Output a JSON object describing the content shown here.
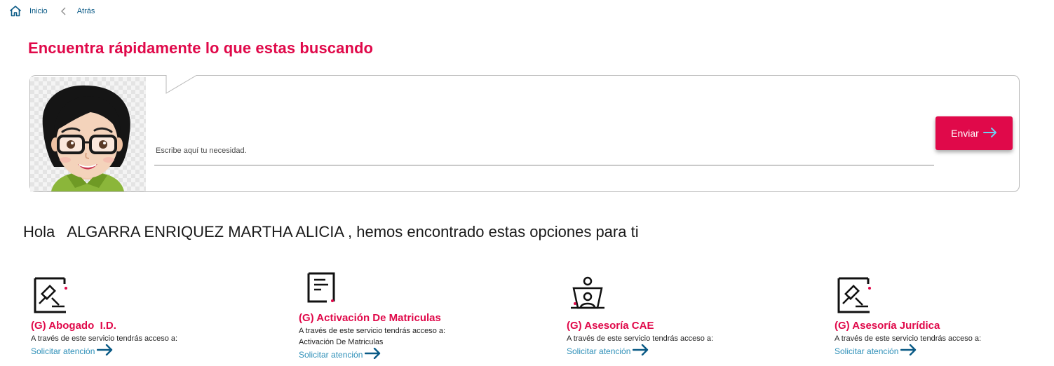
{
  "breadcrumb": {
    "home_label": "Inicio",
    "back_label": "Atrás"
  },
  "headline": "Encuentra rápidamente lo que estas buscando",
  "search": {
    "placeholder": "Escribe aquí tu necesidad.",
    "send_label": "Enviar"
  },
  "greeting": {
    "prefix": "Hola",
    "user_name": "ALGARRA ENRIQUEZ MARTHA ALICIA",
    "suffix": ", hemos encontrado estas opciones para ti"
  },
  "colors": {
    "accent": "#e0094a",
    "link": "#2d8fb8",
    "breadcrumb": "#0a5a86"
  },
  "options": [
    {
      "icon": "gavel-document-icon",
      "title": "(G) Abogado  I.D.",
      "description": "A través de este servicio tendrás acceso a:",
      "extra": "",
      "link_label": "Solicitar atención"
    },
    {
      "icon": "document-list-icon",
      "title": "(G) Activación De Matriculas",
      "description": "A través de este servicio tendrás acceso a:",
      "extra": "Activación De Matriculas",
      "link_label": "Solicitar atención"
    },
    {
      "icon": "advisor-person-icon",
      "title": "(G) Asesoría CAE",
      "description": "A través de este servicio tendrás acceso a:",
      "extra": "",
      "link_label": "Solicitar atención"
    },
    {
      "icon": "gavel-document-icon",
      "title": "(G) Asesoría Jurídica",
      "description": "A través de este servicio tendrás acceso a:",
      "extra": "",
      "link_label": "Solicitar atención"
    }
  ]
}
